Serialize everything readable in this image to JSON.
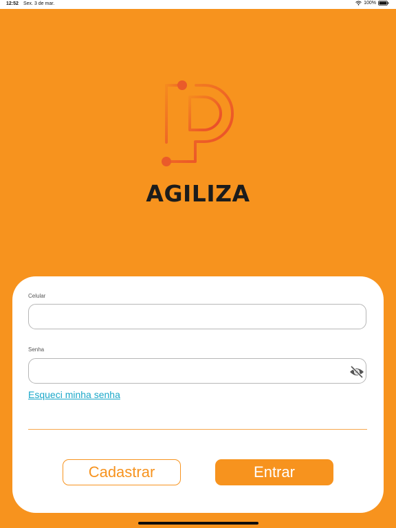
{
  "status_bar": {
    "time": "12:52",
    "date": "Sex. 3 de mar.",
    "battery": "100%"
  },
  "brand": {
    "name": "AGILIZA",
    "logo_icon": "agiliza-p-circuit-logo",
    "logo_gradient": [
      "#f58a1f",
      "#e8452c"
    ]
  },
  "form": {
    "phone_label": "Celular",
    "phone_value": "",
    "password_label": "Senha",
    "password_value": "",
    "forgot_password": "Esqueci minha senha"
  },
  "actions": {
    "register_label": "Cadastrar",
    "login_label": "Entrar"
  },
  "colors": {
    "background": "#f7931e",
    "card": "#ffffff",
    "link": "#1aa7c9",
    "accent": "#f7931e"
  }
}
